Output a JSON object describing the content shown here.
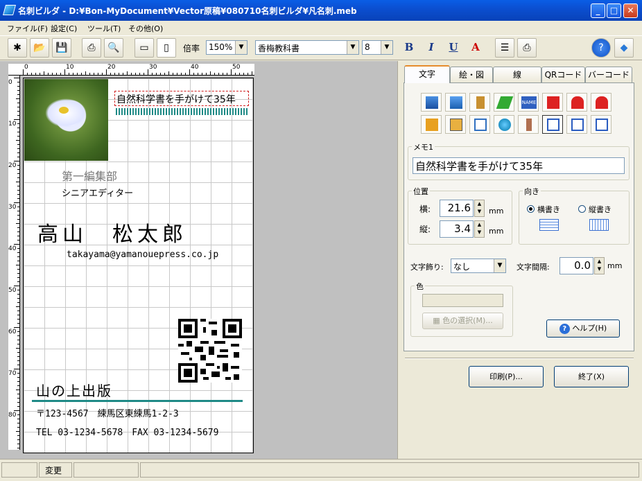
{
  "window": {
    "title": "名刺ビルダ - D:¥Bon-MyDocument¥Vector原稿¥080710名刺ビルダ¥凡名刺.meb",
    "minimize": "_",
    "maximize": "□",
    "close": "✕"
  },
  "menu": [
    "ファイル(F)",
    "設定(C)",
    "ツール(T)",
    "その他(O)"
  ],
  "toolbar": {
    "zoom_label": "倍率",
    "zoom_value": "150%",
    "font_value": "香梅教科書",
    "size_value": "8",
    "bold": "B",
    "italic": "I",
    "underline": "U",
    "color": "A"
  },
  "ruler": {
    "unit": "mm",
    "top_numbers": [
      "0",
      "10",
      "20",
      "30",
      "40",
      "50"
    ],
    "left_numbers": [
      "0",
      "10",
      "20",
      "30",
      "40",
      "50",
      "60",
      "70",
      "80"
    ]
  },
  "card": {
    "memo": "自然科学書を手がけて35年",
    "department": "第一編集部",
    "role": "シニアエディター",
    "name": "高山　松太郎",
    "email": "takayama@yamanouepress.co.jp",
    "company": "山の上出版",
    "address": "〒123-4567　練馬区東練馬1-2-3",
    "phone": "TEL 03-1234-5678　FAX 03-1234-5679"
  },
  "panel": {
    "tabs": [
      "文字",
      "絵・図",
      "線",
      "QRコード",
      "バーコード"
    ],
    "active_tab": "文字",
    "icons": [
      "building-icon",
      "building2-icon",
      "door-icon",
      "phone-icon",
      "name-icon",
      "mailbox-icon",
      "mobile1-icon",
      "mobile2-icon",
      "fax-icon",
      "calculator-icon",
      "mail-icon",
      "globe-icon",
      "pillar-icon",
      "frame1-icon",
      "frame2-icon",
      "frame3-icon"
    ],
    "name_icon_text": "NAME",
    "memo_label": "メモ1",
    "memo_value": "自然科学書を手がけて35年",
    "position_label": "位置",
    "x_label": "横:",
    "x_value": "21.6",
    "y_label": "縦:",
    "y_value": "3.4",
    "unit": "mm",
    "direction_label": "向き",
    "horizontal_label": "横書き",
    "vertical_label": "縦書き",
    "horizontal_selected": true,
    "decoration_label": "文字飾り:",
    "decoration_value": "なし",
    "spacing_label": "文字間隔:",
    "spacing_value": "0.0",
    "color_label": "色",
    "color_button": "色の選択(M)...",
    "help_button": "ヘルプ(H)",
    "print_button": "印刷(P)...",
    "exit_button": "終了(X)"
  },
  "status": {
    "cell2": "変更"
  },
  "colors": {
    "title_blue": "#0b4fd1",
    "teal_bar": "#1f8a86",
    "memo_border": "#d02020"
  }
}
